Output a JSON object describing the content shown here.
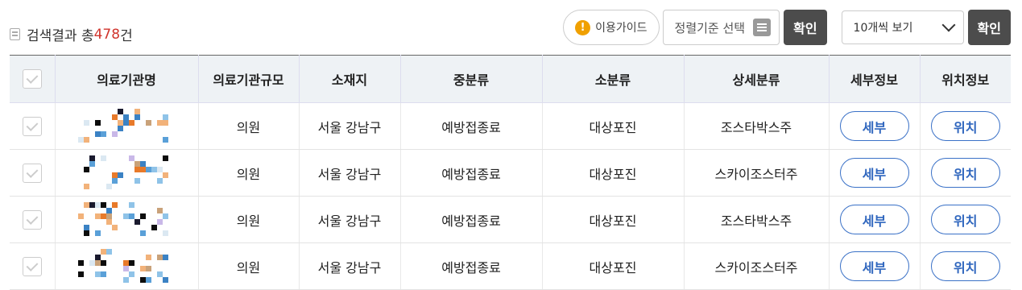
{
  "header": {
    "result_prefix": "검색결과 총",
    "result_count": "478",
    "result_suffix": "건",
    "guide_label": "이용가이드",
    "guide_icon": "!",
    "sort_label": "정렬기준 선택",
    "sort_confirm_label": "확인",
    "page_size_label": "10개씩 보기",
    "page_size_confirm_label": "확인"
  },
  "table": {
    "columns": [
      "의료기관명",
      "의료기관규모",
      "소재지",
      "중분류",
      "소분류",
      "상세분류",
      "세부정보",
      "위치정보"
    ],
    "rows": [
      {
        "name_obscured": true,
        "scale": "의원",
        "location": "서울 강남구",
        "mid": "예방접종료",
        "small": "대상포진",
        "detail": "조스타박스주",
        "info_btn": "세부",
        "loc_btn": "위치"
      },
      {
        "name_obscured": true,
        "scale": "의원",
        "location": "서울 강남구",
        "mid": "예방접종료",
        "small": "대상포진",
        "detail": "스카이조스터주",
        "info_btn": "세부",
        "loc_btn": "위치"
      },
      {
        "name_obscured": true,
        "scale": "의원",
        "location": "서울 강남구",
        "mid": "예방접종료",
        "small": "대상포진",
        "detail": "조스타박스주",
        "info_btn": "세부",
        "loc_btn": "위치"
      },
      {
        "name_obscured": true,
        "scale": "의원",
        "location": "서울 강남구",
        "mid": "예방접종료",
        "small": "대상포진",
        "detail": "스카이조스터주",
        "info_btn": "세부",
        "loc_btn": "위치"
      }
    ]
  },
  "colors": {
    "accent": "#2f66be",
    "count": "#d0342c",
    "dark_button": "#4c4c4c",
    "header_bg": "#eef2f5"
  }
}
